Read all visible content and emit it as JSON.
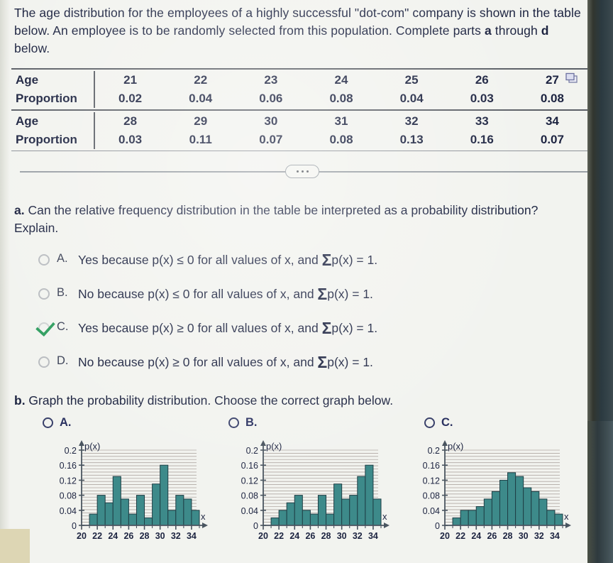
{
  "prompt": {
    "line1": "The age distribution for the employees of a highly successful \"dot-com\" company is shown in the",
    "line2_a": "table below. An employee is to be randomly selected from this population. Complete parts ",
    "line2_b": "a",
    "line3_a": "through ",
    "line3_b": "d",
    "line3_c": " below."
  },
  "table": {
    "row1_header": "Age",
    "row2_header": "Proportion",
    "row3_header": "Age",
    "row4_header": "Proportion",
    "ages_top": [
      "21",
      "22",
      "23",
      "24",
      "25",
      "26",
      "27"
    ],
    "props_top": [
      "0.02",
      "0.04",
      "0.06",
      "0.08",
      "0.04",
      "0.03",
      "0.08"
    ],
    "ages_bottom": [
      "28",
      "29",
      "30",
      "31",
      "32",
      "33",
      "34"
    ],
    "props_bottom": [
      "0.03",
      "0.11",
      "0.07",
      "0.08",
      "0.13",
      "0.16",
      "0.07"
    ],
    "copy_icon": "copy-windows-icon"
  },
  "divider": {
    "icon": "ellipsis-icon"
  },
  "part_a": {
    "label": "a.",
    "text_line1": " Can the relative frequency distribution in the table be interpreted as a probability distribution?",
    "text_line2": "Explain.",
    "options": [
      {
        "key": "A.",
        "pre": "Yes because p(x) ≤ 0 for all values of x, and ",
        "sigma": "Σ",
        "post": "p(x) = 1.",
        "selected": false
      },
      {
        "key": "B.",
        "pre": "No because p(x) ≤ 0 for all values of x, and ",
        "sigma": "Σ",
        "post": "p(x) = 1.",
        "selected": false
      },
      {
        "key": "C.",
        "pre": "Yes because p(x) ≥ 0 for all values of x, and ",
        "sigma": "Σ",
        "post": "p(x) = 1.",
        "selected": true
      },
      {
        "key": "D.",
        "pre": "No because p(x) ≥ 0 for all values of x, and ",
        "sigma": "Σ",
        "post": "p(x) = 1.",
        "selected": false
      }
    ]
  },
  "part_b": {
    "label": "b.",
    "text": " Graph the probability distribution. Choose the correct graph below.",
    "choices": [
      {
        "key": "A.",
        "selected": false
      },
      {
        "key": "B.",
        "selected": false
      },
      {
        "key": "C.",
        "selected": false
      }
    ]
  },
  "colors": {
    "bar_fill": "#3d8a8a",
    "bar_stroke": "#1f3f46",
    "axis": "#4a5560",
    "grid": "#9a8f8a",
    "check_green": "#2f9e5f",
    "radio_blue": "#39406a"
  },
  "chart_data": [
    {
      "type": "bar",
      "name": "graph-a",
      "title": "",
      "xlabel": "x",
      "ylabel": "p(x)",
      "categories": [
        21,
        22,
        23,
        24,
        25,
        26,
        27,
        28,
        29,
        30,
        31,
        32,
        33,
        34
      ],
      "values": [
        0.03,
        0.08,
        0.06,
        0.13,
        0.07,
        0.03,
        0.08,
        0.02,
        0.11,
        0.16,
        0.04,
        0.08,
        0.07,
        0.04
      ],
      "xticks": [
        20,
        22,
        24,
        26,
        28,
        30,
        32,
        34
      ],
      "xtick_labels": [
        "20",
        "22",
        "24",
        "26",
        "28",
        "30",
        "32",
        "34"
      ],
      "yticks": [
        0,
        0.04,
        0.08,
        0.12,
        0.16,
        0.2
      ],
      "ytick_labels": [
        "0",
        "0.04",
        "0.08",
        "0.12",
        "0.16",
        "0.2"
      ],
      "xlim": [
        20,
        35
      ],
      "ylim": [
        0,
        0.2
      ],
      "grid": true,
      "legend": "none"
    },
    {
      "type": "bar",
      "name": "graph-b",
      "title": "",
      "xlabel": "x",
      "ylabel": "p(x)",
      "categories": [
        21,
        22,
        23,
        24,
        25,
        26,
        27,
        28,
        29,
        30,
        31,
        32,
        33,
        34
      ],
      "values": [
        0.02,
        0.04,
        0.06,
        0.08,
        0.04,
        0.03,
        0.08,
        0.03,
        0.11,
        0.07,
        0.08,
        0.13,
        0.16,
        0.07
      ],
      "xticks": [
        20,
        22,
        24,
        26,
        28,
        30,
        32,
        34
      ],
      "xtick_labels": [
        "20",
        "22",
        "24",
        "26",
        "28",
        "30",
        "32",
        "34"
      ],
      "yticks": [
        0,
        0.04,
        0.08,
        0.12,
        0.16,
        0.2
      ],
      "ytick_labels": [
        "0",
        "0.04",
        "0.08",
        "0.12",
        "0.16",
        "0.2"
      ],
      "xlim": [
        20,
        35
      ],
      "ylim": [
        0,
        0.2
      ],
      "grid": true,
      "legend": "none"
    },
    {
      "type": "bar",
      "name": "graph-c",
      "title": "",
      "xlabel": "x",
      "ylabel": "p(x)",
      "categories": [
        21,
        22,
        23,
        24,
        25,
        26,
        27,
        28,
        29,
        30,
        31,
        32,
        33,
        34
      ],
      "values": [
        0.02,
        0.04,
        0.04,
        0.05,
        0.07,
        0.09,
        0.12,
        0.14,
        0.13,
        0.1,
        0.09,
        0.07,
        0.04,
        0.03
      ],
      "xticks": [
        20,
        22,
        24,
        26,
        28,
        30,
        32,
        34
      ],
      "xtick_labels": [
        "20",
        "22",
        "24",
        "26",
        "28",
        "30",
        "32",
        "34"
      ],
      "yticks": [
        0,
        0.04,
        0.08,
        0.12,
        0.16,
        0.2
      ],
      "ytick_labels": [
        "0",
        "0.04",
        "0.08",
        "0.12",
        "0.16",
        "0.2"
      ],
      "xlim": [
        20,
        35
      ],
      "ylim": [
        0,
        0.2
      ],
      "grid": true,
      "legend": "none"
    }
  ]
}
